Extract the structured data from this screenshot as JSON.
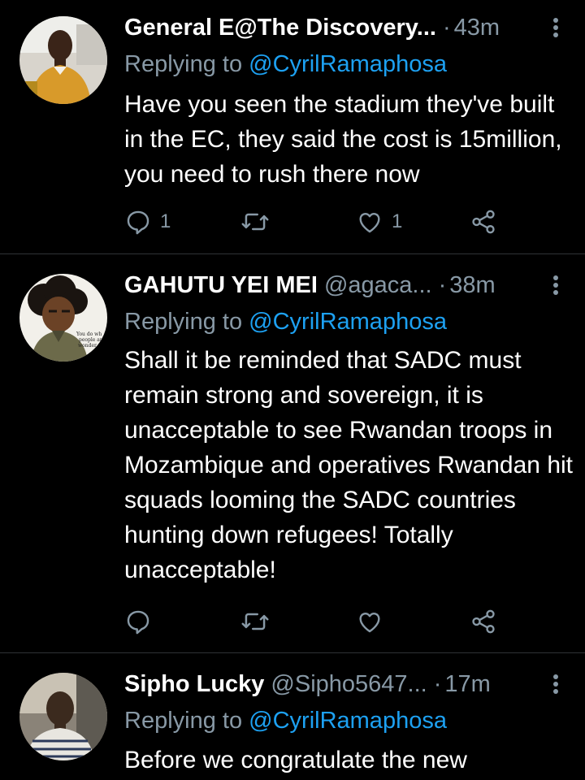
{
  "tweets": [
    {
      "name": "General E@The Discovery...",
      "handle": "",
      "time": "43m",
      "dot": "·",
      "replying_prefix": "Replying to ",
      "replying_mention": "@CyrilRamaphosa",
      "text": "Have you seen the stadium they've built in the EC, they said the cost is 15million, you need to rush there now",
      "reply_count": "1",
      "retweet_count": "",
      "like_count": "1"
    },
    {
      "name": "GAHUTU YEI MEI",
      "handle": "@agaca...",
      "time": "38m",
      "dot": "·",
      "replying_prefix": "Replying to ",
      "replying_mention": "@CyrilRamaphosa",
      "text": "Shall it be reminded that SADC must remain strong and sovereign, it is unacceptable to see Rwandan troops in Mozambique and operatives Rwandan hit squads looming the SADC countries hunting down refugees! Totally unacceptable!",
      "reply_count": "",
      "retweet_count": "",
      "like_count": ""
    },
    {
      "name": "Sipho Lucky",
      "handle": "@Sipho5647...",
      "time": "17m",
      "dot": "·",
      "replying_prefix": "Replying to ",
      "replying_mention": "@CyrilRamaphosa",
      "text": "Before we congratulate the new"
    }
  ],
  "icons": {
    "reply": "reply-icon",
    "retweet": "retweet-icon",
    "like": "heart-icon",
    "share": "share-icon",
    "more": "more-vertical-icon"
  },
  "colors": {
    "background": "#000000",
    "text": "#ffffff",
    "secondary": "#8899a6",
    "link": "#1da1f2",
    "divider": "#2f3336"
  }
}
